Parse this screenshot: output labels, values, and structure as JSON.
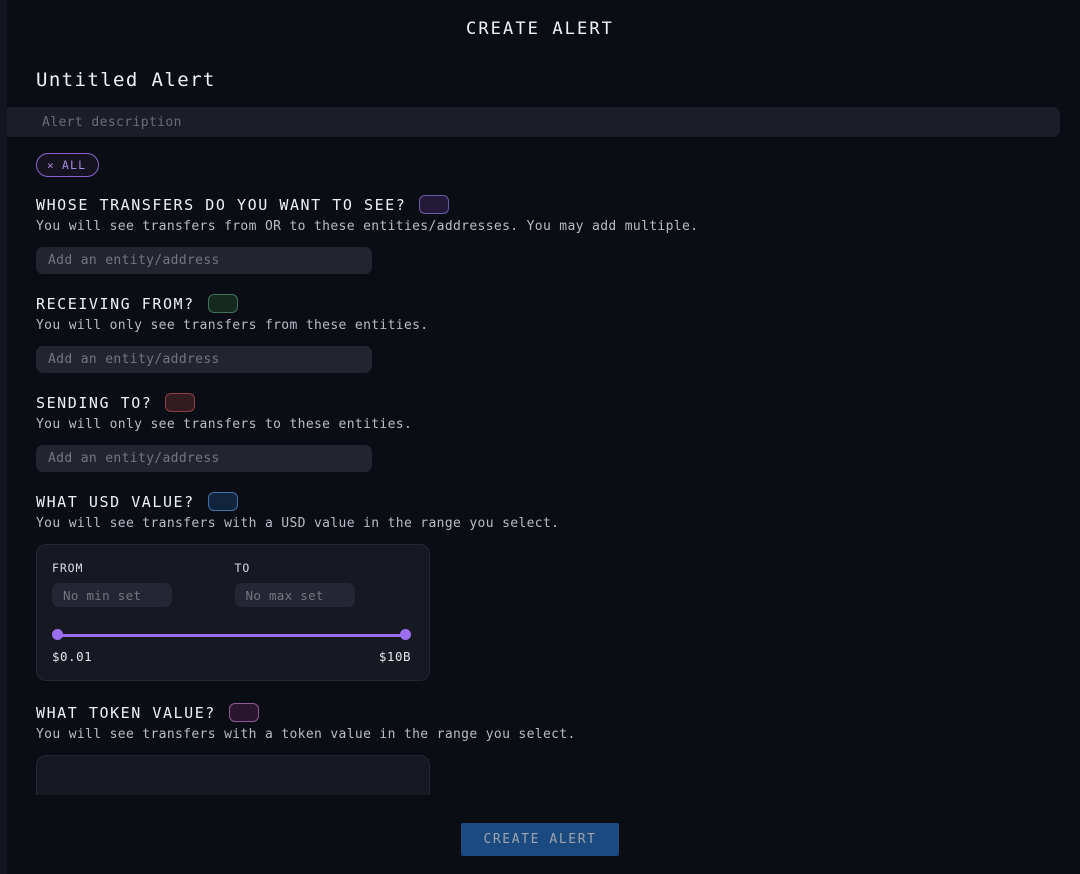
{
  "header": {
    "title": "CREATE ALERT"
  },
  "alert": {
    "name": "Untitled Alert",
    "description_value": "",
    "description_placeholder": "Alert description"
  },
  "chips": [
    {
      "label": "ALL",
      "remove_icon": "×",
      "accent": "#8a63d2"
    }
  ],
  "sections": [
    {
      "id": "whose-transfers",
      "title": "WHOSE TRANSFERS DO YOU WANT TO SEE?",
      "swatch_fill": "#221a38",
      "swatch_border": "#6f5ca8",
      "subtitle": "You will see transfers from OR to these entities/addresses. You may add multiple.",
      "input_value": "",
      "input_placeholder": "Add an entity/address"
    },
    {
      "id": "receiving-from",
      "title": "RECEIVING FROM?",
      "swatch_fill": "#15291f",
      "swatch_border": "#3f7158",
      "subtitle": "You will only see transfers from these entities.",
      "input_value": "",
      "input_placeholder": "Add an entity/address"
    },
    {
      "id": "sending-to",
      "title": "SENDING TO?",
      "swatch_fill": "#341a21",
      "swatch_border": "#8b4047",
      "subtitle": "You will only see transfers to these entities.",
      "input_value": "",
      "input_placeholder": "Add an entity/address"
    }
  ],
  "usd_section": {
    "id": "what-usd-value",
    "title": "WHAT USD VALUE?",
    "swatch_fill": "#12243c",
    "swatch_border": "#3d72ad",
    "subtitle": "You will see transfers with a USD value in the range you select.",
    "from_label": "FROM",
    "to_label": "TO",
    "from_value": "",
    "from_placeholder": "No min set",
    "to_value": "",
    "to_placeholder": "No max set",
    "min_bound": "$0.01",
    "max_bound": "$10B",
    "slider_accent": "#9b6ef0"
  },
  "token_section": {
    "id": "what-token-value",
    "title": "WHAT TOKEN VALUE?",
    "swatch_fill": "#2b1630",
    "swatch_border": "#8e5b96",
    "subtitle": "You will see transfers with a token value in the range you select."
  },
  "footer": {
    "create_label": "CREATE ALERT",
    "create_bg": "#1b4a80"
  }
}
